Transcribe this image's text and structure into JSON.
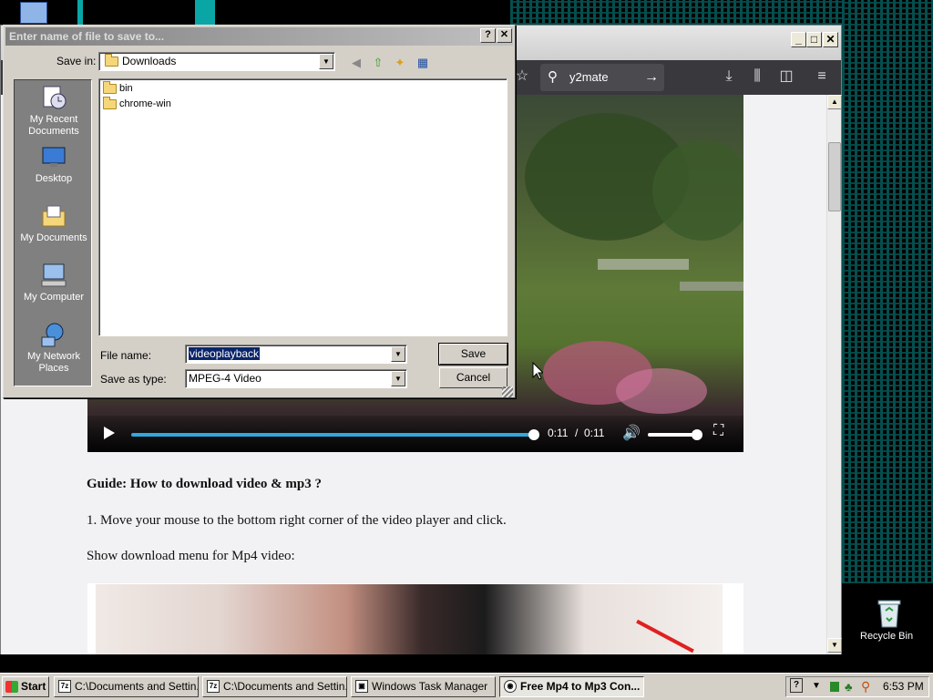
{
  "desktop": {
    "recycle_bin_label": "Recycle Bin"
  },
  "browser": {
    "url_text": "y2mate",
    "window_buttons": [
      "_",
      "□",
      "✕"
    ],
    "video": {
      "time_current": "0:11",
      "time_separator": "/",
      "time_total": "0:11",
      "progress_fraction": 1.0,
      "volume_fraction": 1.0
    },
    "guide_title": "Guide: How to download video & mp3 ?",
    "step1": "1. Move your mouse to the bottom right corner of the video player and click.",
    "step2": "Show download menu for Mp4 video:"
  },
  "dialog": {
    "title": "Enter name of file to save to...",
    "help_btn": "?",
    "close_btn": "✕",
    "save_in_label": "Save in:",
    "save_in_value": "Downloads",
    "places": [
      {
        "label": "My Recent Documents",
        "icon": "recent-documents-icon"
      },
      {
        "label": "Desktop",
        "icon": "desktop-icon"
      },
      {
        "label": "My Documents",
        "icon": "my-documents-icon"
      },
      {
        "label": "My Computer",
        "icon": "my-computer-icon"
      },
      {
        "label": "My Network Places",
        "icon": "network-places-icon"
      }
    ],
    "files": [
      "bin",
      "chrome-win"
    ],
    "file_name_label": "File name:",
    "file_name_value": "videoplayback",
    "save_as_type_label": "Save as type:",
    "save_as_type_value": "MPEG-4 Video",
    "save_button": "Save",
    "cancel_button": "Cancel"
  },
  "taskbar": {
    "start_label": "Start",
    "tasks": [
      {
        "label": "C:\\Documents and Settin...",
        "active": false
      },
      {
        "label": "C:\\Documents and Settin...",
        "active": false
      },
      {
        "label": "Windows Task Manager",
        "active": false
      },
      {
        "label": "Free Mp4 to Mp3 Con...",
        "active": true
      }
    ],
    "clock": "6:53 PM"
  },
  "colors": {
    "desktop_teal": "#0aa6a6",
    "browser_toolbar": "#38383d",
    "video_progress": "#30a8e0",
    "selection": "#0a246a",
    "dialog_face": "#d4d0c8"
  }
}
